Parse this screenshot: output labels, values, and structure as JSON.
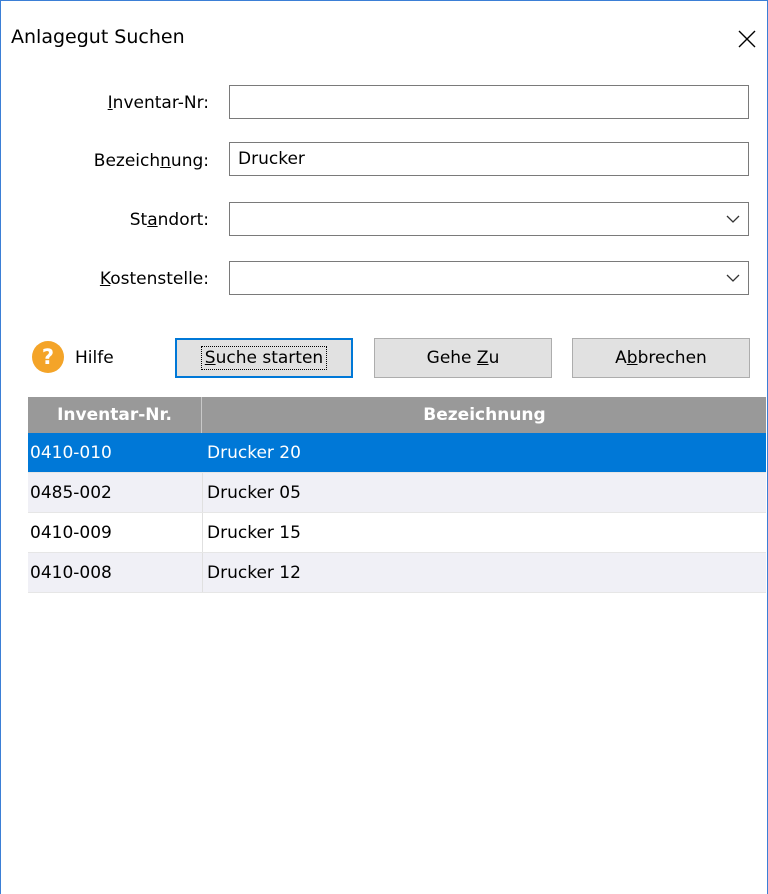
{
  "window": {
    "title": "Anlagegut Suchen"
  },
  "form": {
    "inventar_nr": {
      "label_pre": "",
      "label_u": "I",
      "label_post": "nventar-Nr:",
      "value": ""
    },
    "bezeichnung": {
      "label_pre": "Bezeich",
      "label_u": "n",
      "label_post": "ung:",
      "value": "Drucker"
    },
    "standort": {
      "label_pre": "St",
      "label_u": "a",
      "label_post": "ndort:",
      "value": ""
    },
    "kostenstelle": {
      "label_pre": "",
      "label_u": "K",
      "label_post": "ostenstelle:",
      "value": ""
    }
  },
  "toolbar": {
    "help_label": "Hilfe",
    "help_icon": "question-icon",
    "help_glyph": "?",
    "search": {
      "pre": "",
      "u": "S",
      "post": "uche starten"
    },
    "goto": {
      "pre": "Gehe ",
      "u": "Z",
      "post": "u"
    },
    "cancel": {
      "pre": "A",
      "u": "b",
      "post": "brechen"
    }
  },
  "colors": {
    "accent": "#0078d7",
    "help_icon": "#f4a428",
    "header_bg": "#999999"
  },
  "results": {
    "columns": [
      "Inventar-Nr.",
      "Bezeichnung"
    ],
    "rows": [
      {
        "inventar_nr": "0410-010",
        "bezeichnung": "Drucker 20",
        "selected": true
      },
      {
        "inventar_nr": "0485-002",
        "bezeichnung": "Drucker 05",
        "selected": false
      },
      {
        "inventar_nr": "0410-009",
        "bezeichnung": "Drucker 15",
        "selected": false
      },
      {
        "inventar_nr": "0410-008",
        "bezeichnung": "Drucker 12",
        "selected": false
      }
    ]
  }
}
